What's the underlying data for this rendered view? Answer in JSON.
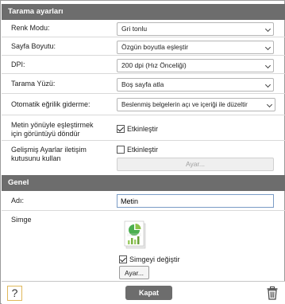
{
  "scan_section": {
    "title": "Tarama ayarları",
    "color_mode": {
      "label": "Renk Modu:",
      "value": "Gri tonlu"
    },
    "page_size": {
      "label": "Sayfa Boyutu:",
      "value": "Özgün boyutla eşleştir"
    },
    "dpi": {
      "label": "DPI:",
      "value": "200 dpi (Hız Önceliği)"
    },
    "scan_side": {
      "label": "Tarama Yüzü:",
      "value": "Boş sayfa atla"
    },
    "deskew": {
      "label": "Otomatik eğrilik giderme:",
      "value": "Beslenmiş belgelerin açı ve içeriği ile düzeltir"
    },
    "rotate_text": {
      "label": "Metin yönüyle eşleştirmek\niçin görüntüyü döndür",
      "checkbox_label": "Etkinleştir",
      "checked": true
    },
    "advanced": {
      "label": "Gelişmiş Ayarlar iletişim\nkutusunu kullan",
      "checkbox_label": "Etkinleştir",
      "checked": false,
      "button_label": "Ayar..."
    }
  },
  "general_section": {
    "title": "Genel",
    "name": {
      "label": "Adı:",
      "value": "Metin"
    },
    "icon": {
      "label": "Simge",
      "checkbox_label": "Simgeyi değiştir",
      "checked": true,
      "button_label": "Ayar..."
    }
  },
  "footer": {
    "help_label": "?",
    "close_label": "Kapat"
  }
}
